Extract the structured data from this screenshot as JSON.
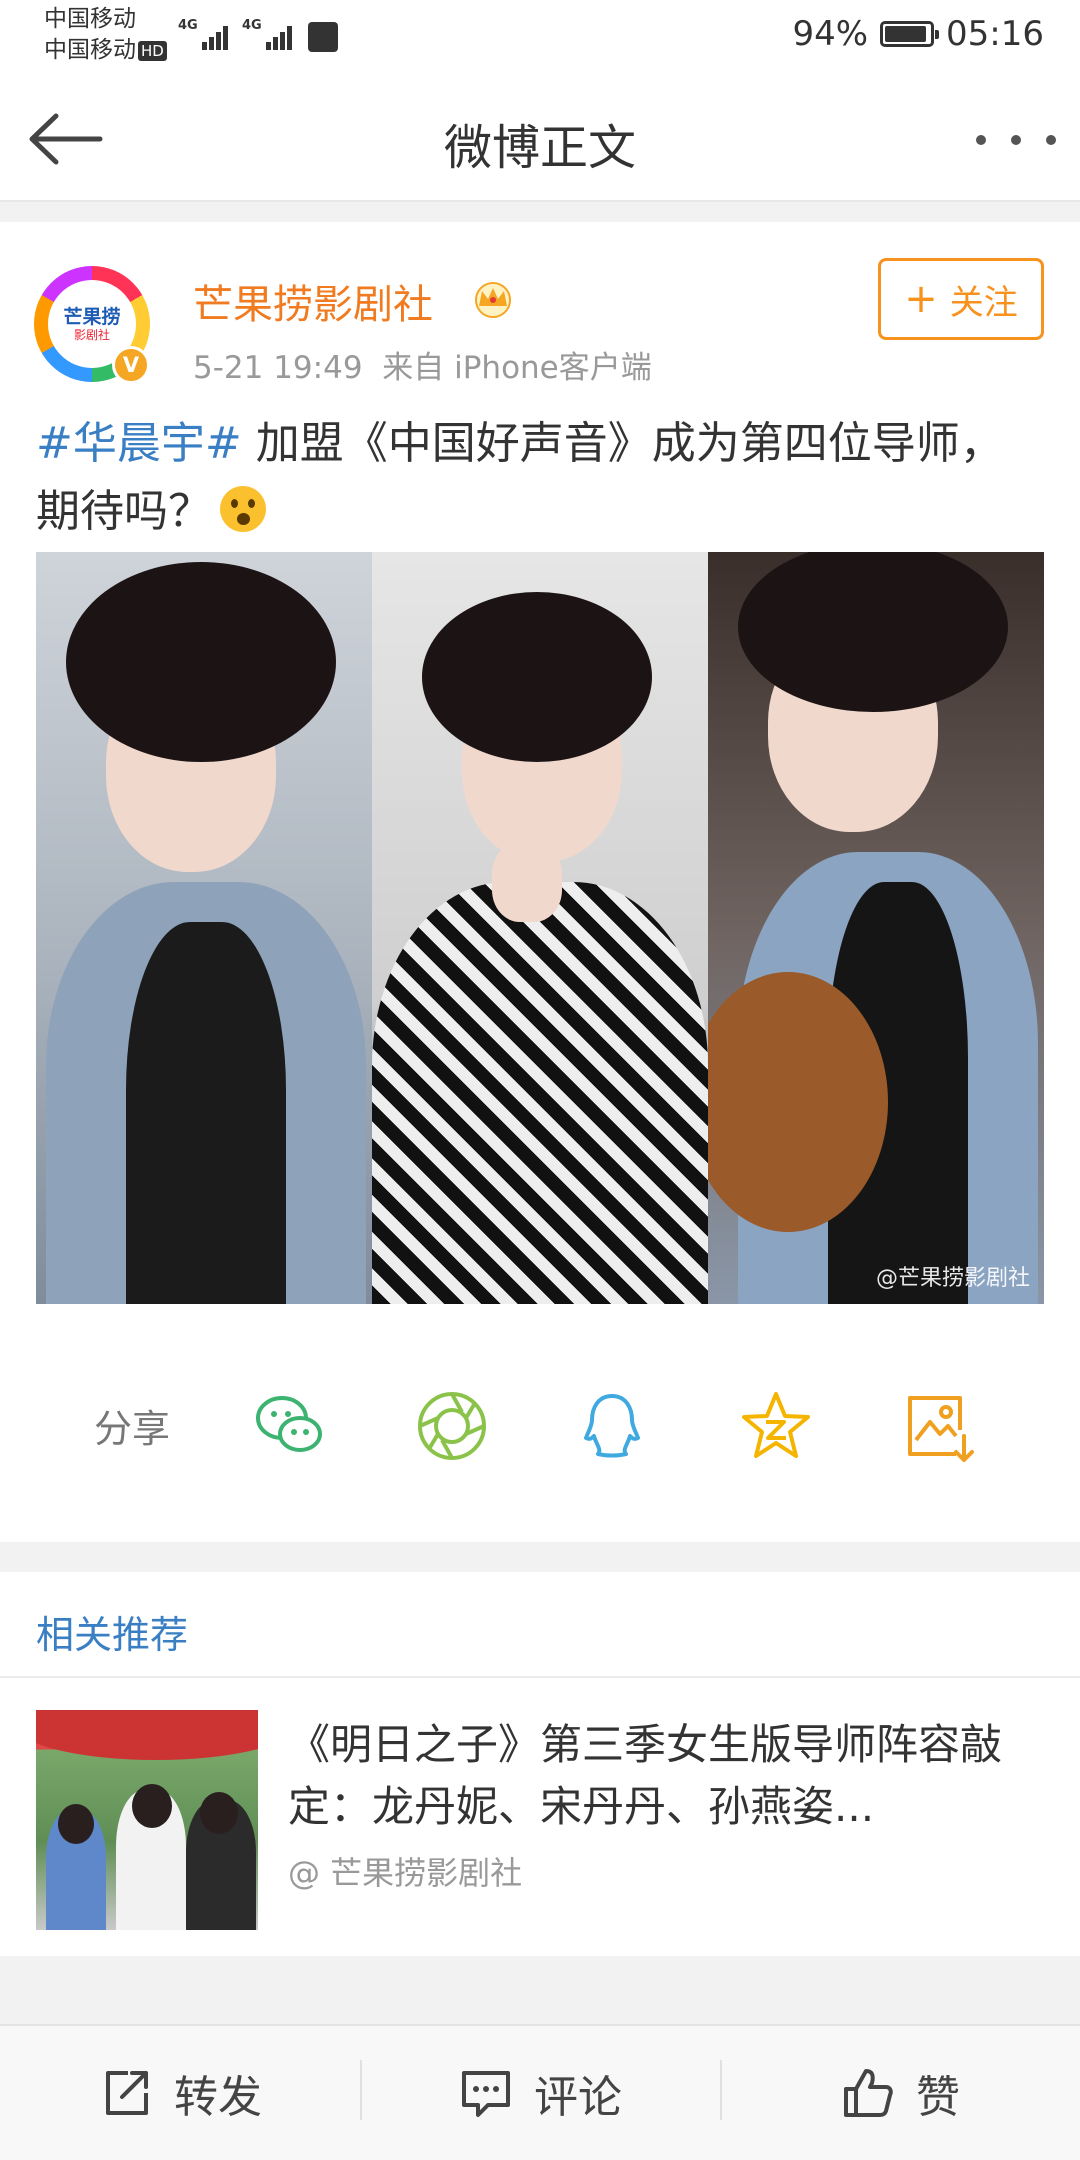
{
  "status_bar": {
    "carrier1": "中国移动",
    "carrier2": "中国移动",
    "hd": "HD",
    "net1": "4G",
    "net2": "4G",
    "battery_pct_text": "94%",
    "battery_level": 0.94,
    "time": "05:16"
  },
  "nav": {
    "title": "微博正文",
    "back_icon": "arrow-left-icon",
    "more_icon": "more-dots-icon"
  },
  "post": {
    "author": "芒果捞影剧社",
    "avatar_text_1": "芒果捞",
    "avatar_text_2": "影剧社",
    "verified_badge": "V",
    "time": "5-21 19:49",
    "source": "来自 iPhone客户端",
    "follow_label": "关注",
    "topic": "#华晨宇#",
    "text": " 加盟《中国好声音》成为第四位导师，期待吗？",
    "watermark": "@芒果捞影剧社",
    "accent_color": "#f7921e",
    "link_color": "#3a7fc4"
  },
  "share": {
    "label": "分享",
    "icons": [
      "wechat-icon",
      "moments-icon",
      "qq-icon",
      "qzone-star-icon",
      "save-image-icon"
    ]
  },
  "related": {
    "title": "相关推荐",
    "item_title": "《明日之子》第三季女生版导师阵容敲定：龙丹妮、宋丹丹、孙燕姿...",
    "item_source": "@ 芒果捞影剧社"
  },
  "bottom_bar": {
    "repost": "转发",
    "comment": "评论",
    "like": "赞"
  }
}
